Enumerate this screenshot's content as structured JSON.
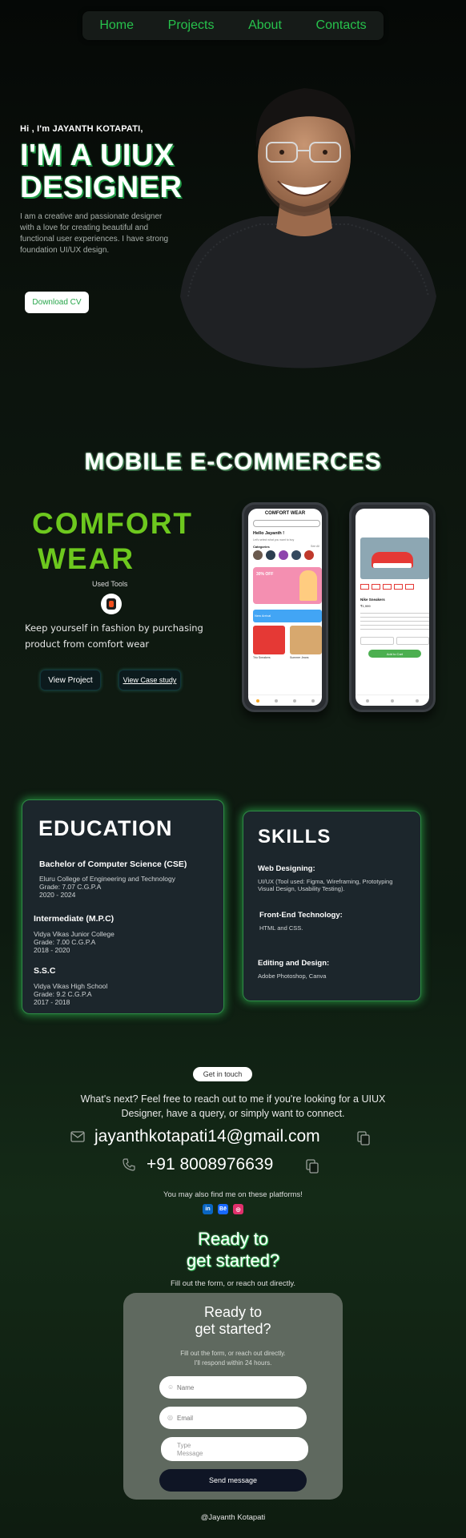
{
  "nav": {
    "items": [
      "Home",
      "Projects",
      "About",
      "Contacts"
    ]
  },
  "hero": {
    "greeting": "Hi , I'm JAYANTH KOTAPATI,",
    "title": "I'M A UIUX DESIGNER",
    "description": "I am a creative and passionate designer with a love for creating beautiful and functional user experiences. I have strong foundation UI/UX design.",
    "cta": "Download CV"
  },
  "project": {
    "section_title": "MOBILE E-COMMERCES",
    "name_line1": "COMFORT",
    "name_line2": "WEAR",
    "used_tools_label": "Used Tools",
    "tool_icon": "figma-icon",
    "description": "Keep yourself in fashion by purchasing product from comfort wear",
    "view_project": "View Project",
    "view_case": "View Case study",
    "phone1": {
      "brand": "COMFORT WEAR",
      "greeting": "Hello Jayanth !",
      "subtitle": "Let's select what you want to buy",
      "categories_label": "Categories",
      "see_all": "See All",
      "promo": "30% OFF",
      "new_label": "New Arrival",
      "item1": "Trio Sneakers",
      "item2": "Summer Jeans"
    },
    "phone2": {
      "label": "Nike Sneakers",
      "price": "₹1,999",
      "button": "Add to Cart"
    }
  },
  "education": {
    "title": "EDUCATION",
    "entries": [
      {
        "degree": "Bachelor of Computer Science (CSE)",
        "school": "Eluru College of Engineering and Technology",
        "grade": "Grade: 7.07 C.G.P.A",
        "years": "2020 - 2024"
      },
      {
        "degree": "Intermediate (M.P.C)",
        "school": "Vidya Vikas Junior College",
        "grade": "Grade: 7.00 C.G.P.A",
        "years": "2018 - 2020"
      },
      {
        "degree": "S.S.C",
        "school": "Vidya Vikas High School",
        "grade": "Grade: 9.2 C.G.P.A",
        "years": "2017 - 2018"
      }
    ]
  },
  "skills": {
    "title": "SKILLS",
    "entries": [
      {
        "heading": "Web Designing:",
        "detail": "UI/UX (Tool used: Figma, Wireframing, Prototyping Visual Design, Usability Testing)."
      },
      {
        "heading": "Front-End Technology:",
        "detail": "HTML and CSS."
      },
      {
        "heading": "Editing and Design:",
        "detail": "Adobe Photoshop, Canva"
      }
    ]
  },
  "contact": {
    "pill": "Get in touch",
    "next": "What's next? Feel free to reach out to me if you're looking for a UIUX Designer, have a query, or simply want to connect.",
    "email": "jayanthkotapati14@gmail.com",
    "phone": "+91 8008976639",
    "find": "You may also find me on these platforms!",
    "socials": [
      {
        "icon": "linkedin-icon",
        "label": "in",
        "color": "#0a66c2"
      },
      {
        "icon": "behance-icon",
        "label": "Bē",
        "color": "#1769ff"
      },
      {
        "icon": "instagram-icon",
        "label": "◎",
        "color": "#e1306c"
      }
    ]
  },
  "ready": {
    "title_line1": "Ready to",
    "title_line2": "get started?",
    "sub": "Fill out the form, or reach out directly."
  },
  "form": {
    "title_line1": "Ready to",
    "title_line2": "get started?",
    "sub_line1": "Fill out the form, or reach out directly.",
    "sub_line2": "I'll respond within 24 hours.",
    "name_placeholder": "Name",
    "email_placeholder": "Email",
    "type_placeholder": "Type",
    "message_placeholder": "Message",
    "send": "Send message"
  },
  "footer": "@Jayanth Kotapati",
  "colors": {
    "accent": "#27c24c",
    "comfort": "#6dc81e",
    "card": "#1c262c"
  }
}
